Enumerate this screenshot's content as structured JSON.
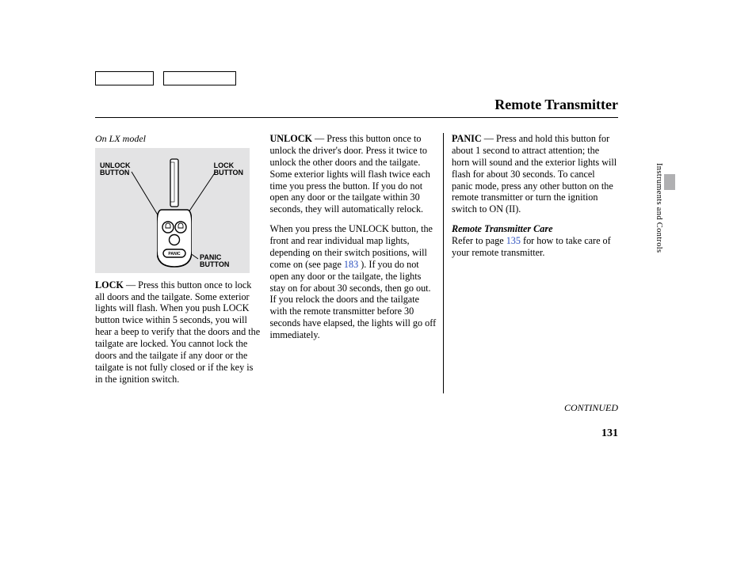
{
  "header": {
    "title": "Remote Transmitter"
  },
  "sidebar": {
    "section": "Instruments and Controls"
  },
  "footer": {
    "continued": "CONTINUED",
    "page": "131"
  },
  "figure": {
    "caption": "On LX model",
    "labels": {
      "unlock": "UNLOCK\nBUTTON",
      "lock": "LOCK\nBUTTON",
      "panic": "PANIC\nBUTTON",
      "panic_word_on_button": "PANIC"
    }
  },
  "col1": {
    "lock_label": "LOCK",
    "lock_gap": " — ",
    "lock_body": "Press this button once to lock all doors and the tailgate. Some exterior lights will flash. When you push LOCK button twice within 5 seconds, you will hear a beep to verify that the doors and the tailgate are locked. You cannot lock the doors and the tailgate if any door or the tailgate is not fully closed or if the key is in the ignition switch."
  },
  "col2": {
    "unlock_label": "UNLOCK",
    "unlock_gap": " — ",
    "unlock_body": "Press this button once to unlock the driver's door. Press it twice to unlock the other doors and the tailgate. Some exterior lights will flash twice each time you press the button. If you do not open any door or the tailgate within 30 seconds, they will automatically relock.",
    "para2_a": "When you press the UNLOCK button, the front and rear individual map lights, depending on their switch positions, will come on (see page ",
    "para2_link": "183",
    "para2_b": " ). If you do not open any door or the tailgate, the lights stay on for about 30 seconds, then go out. If you relock the doors and the tailgate with the remote transmitter before 30 seconds have elapsed, the lights will go off immediately."
  },
  "col3": {
    "panic_label": "PANIC",
    "panic_gap": " — ",
    "panic_body": "Press and hold this button for about 1 second to attract attention; the horn will sound and the exterior lights will flash for about 30 seconds. To cancel panic mode, press any other button on the remote transmitter or turn the ignition switch to ON (II).",
    "care_heading": "Remote Transmitter Care",
    "care_a": "Refer to page ",
    "care_link": "135",
    "care_b": " for how to take care of your remote transmitter."
  }
}
